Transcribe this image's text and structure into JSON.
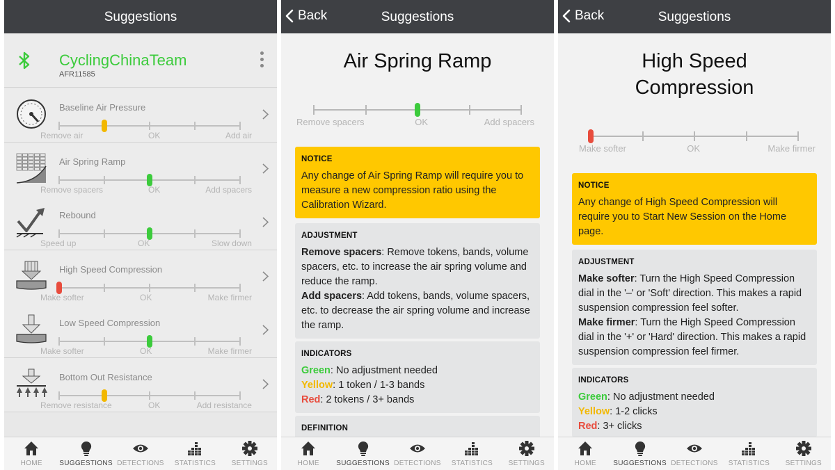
{
  "colors": {
    "navbar": "#3e4044",
    "green": "#3ccb3c",
    "yellow": "#f2b800",
    "red": "#e84c3d",
    "notice": "#ffc800"
  },
  "nav": {
    "title": "Suggestions",
    "back": "Back"
  },
  "tabs": [
    "HOME",
    "SUGGESTIONS",
    "DETECTIONS",
    "STATISTICS",
    "SETTINGS"
  ],
  "tab_icons": [
    "home-icon",
    "lightbulb-icon",
    "eye-icon",
    "statistics-icon",
    "gear-icon"
  ],
  "device": {
    "name": "CyclingChinaTeam",
    "id": "AFR11585"
  },
  "suggestions": [
    {
      "label": "Baseline Air Pressure",
      "left": "Remove air",
      "mid": "OK",
      "right": "Add air",
      "level": 0.25,
      "status": "yellow",
      "icon": "gauge-icon"
    },
    {
      "label": "Air Spring Ramp",
      "left": "Remove spacers",
      "mid": "OK",
      "right": "Add spacers",
      "level": 0.5,
      "status": "green",
      "icon": "air-spring-ramp-icon"
    },
    {
      "label": "Rebound",
      "left": "Speed up",
      "mid": "OK",
      "right": "Slow down",
      "level": 0.5,
      "status": "green",
      "icon": "rebound-icon"
    },
    {
      "label": "High Speed Compression",
      "left": "Make softer",
      "mid": "OK",
      "right": "Make firmer",
      "level": 0.0,
      "status": "red",
      "icon": "high-speed-compression-icon"
    },
    {
      "label": "Low Speed Compression",
      "left": "Make softer",
      "mid": "OK",
      "right": "Make firmer",
      "level": 0.5,
      "status": "green",
      "icon": "low-speed-compression-icon"
    },
    {
      "label": "Bottom Out Resistance",
      "left": "Remove resistance",
      "mid": "OK",
      "right": "Add resistance",
      "level": 0.25,
      "status": "yellow",
      "icon": "bottom-out-icon"
    }
  ],
  "detail1": {
    "title": "Air Spring Ramp",
    "slider": {
      "left": "Remove spacers",
      "mid": "OK",
      "right": "Add spacers",
      "level": 0.5,
      "status": "green"
    },
    "notice_head": "NOTICE",
    "notice_text": "Any change of Air Spring Ramp will require you to measure a new compression ratio using the Calibration Wizard.",
    "adj_head": "ADJUSTMENT",
    "adj1_term": "Remove spacers",
    "adj1_text": ": Remove tokens, bands, volume spacers, etc. to increase the air spring volume and reduce the ramp.",
    "adj2_term": "Add spacers",
    "adj2_text": ": Add tokens, bands, volume spacers, etc. to decrease the air spring volume and increase the ramp.",
    "ind_head": "INDICATORS",
    "green_term": "Green",
    "green_text": ": No adjustment needed",
    "yellow_term": "Yellow",
    "yellow_text": ": 1 token / 1-3 bands",
    "red_term": "Red",
    "red_text": ": 2 tokens / 3+ bands",
    "def_head": "DEFINITION"
  },
  "detail2": {
    "title_line1": "High Speed",
    "title_line2": "Compression",
    "slider": {
      "left": "Make softer",
      "mid": "OK",
      "right": "Make firmer",
      "level": 0.0,
      "status": "red"
    },
    "notice_head": "NOTICE",
    "notice_text": "Any change of High Speed Compression will require you to Start New Session on the Home page.",
    "adj_head": "ADJUSTMENT",
    "adj1_term": "Make softer",
    "adj1_text": ": Turn the High Speed Compression dial in the '–' or 'Soft' direction. This makes a rapid suspension compression feel softer.",
    "adj2_term": "Make firmer",
    "adj2_text": ": Turn the High Speed Compression dial in the '+' or 'Hard' direction. This makes a rapid suspension compression feel firmer.",
    "ind_head": "INDICATORS",
    "green_term": "Green",
    "green_text": ": No adjustment needed",
    "yellow_term": "Yellow",
    "yellow_text": ": 1-2 clicks",
    "red_term": "Red",
    "red_text": ": 3+ clicks"
  }
}
